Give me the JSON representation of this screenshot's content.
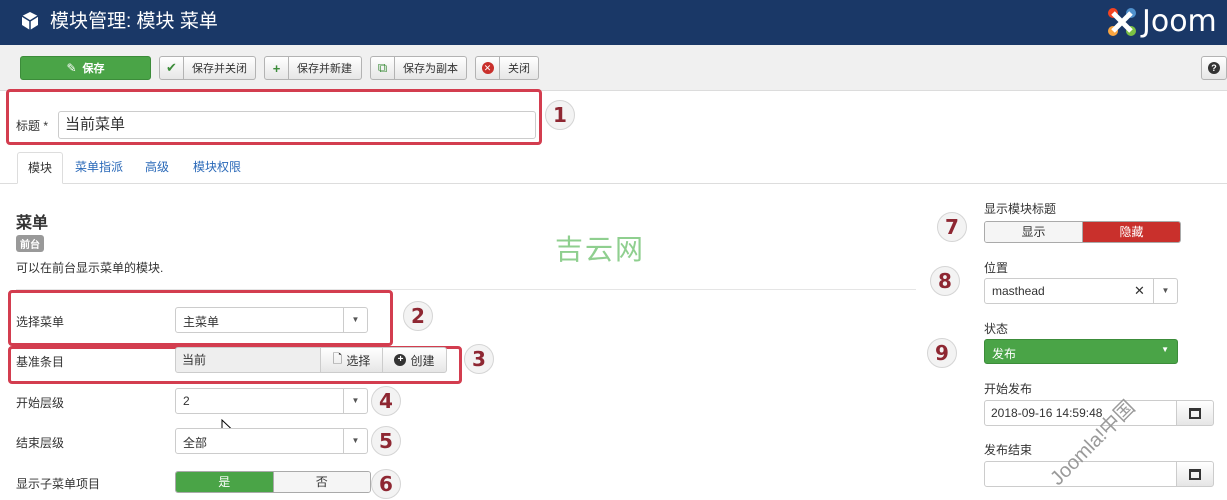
{
  "header": {
    "title": "模块管理: 模块 菜单",
    "logo_text": "Joom"
  },
  "toolbar": {
    "save": "保存",
    "save_close": "保存并关闭",
    "save_new": "保存并新建",
    "save_copy": "保存为副本",
    "close": "关闭",
    "help": "?"
  },
  "form": {
    "title_label": "标题 *",
    "title_value": "当前菜单"
  },
  "tabs": [
    "模块",
    "菜单指派",
    "高级",
    "模块权限"
  ],
  "module": {
    "name": "菜单",
    "badge": "前台",
    "description": "可以在前台显示菜单的模块.",
    "watermark": "吉云网"
  },
  "fields": {
    "select_menu_label": "选择菜单",
    "select_menu_value": "主菜单",
    "base_item_label": "基准条目",
    "base_item_value": "当前",
    "base_item_select": "选择",
    "base_item_create": "创建",
    "start_level_label": "开始层级",
    "start_level_value": "2",
    "end_level_label": "结束层级",
    "end_level_value": "全部",
    "show_sub_label": "显示子菜单项目",
    "show_sub_yes": "是",
    "show_sub_no": "否"
  },
  "sidebar": {
    "show_title_label": "显示模块标题",
    "show_title_show": "显示",
    "show_title_hide": "隐藏",
    "position_label": "位置",
    "position_value": "masthead",
    "status_label": "状态",
    "status_value": "发布",
    "start_publish_label": "开始发布",
    "start_publish_value": "2018-09-16 14:59:48",
    "finish_publish_label": "发布结束",
    "finish_publish_value": ""
  },
  "markers": [
    "1",
    "2",
    "3",
    "4",
    "5",
    "6",
    "7",
    "8",
    "9"
  ],
  "diagonal_watermark": "Joomla!中国",
  "colors": {
    "header_bg": "#1a3867",
    "save_green": "#4aa447",
    "hide_red": "#c9302c",
    "marker_red": "#d33d4f"
  }
}
